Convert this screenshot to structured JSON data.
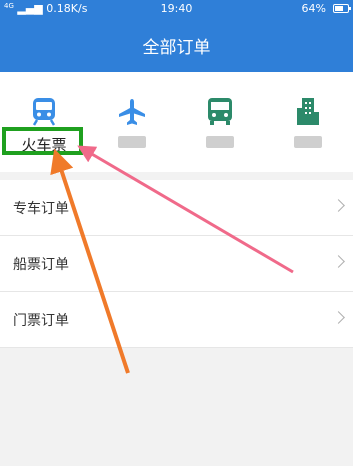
{
  "status_bar": {
    "network": "4G",
    "speed": "0.18K/s",
    "time": "19:40",
    "battery": "64%",
    "battery_level": 0.64
  },
  "header": {
    "title": "全部订单"
  },
  "categories": [
    {
      "label": "火车票",
      "icon": "train-icon",
      "color": "#3a8ee6"
    },
    {
      "label": "",
      "icon": "plane-icon",
      "color": "#3a8ee6"
    },
    {
      "label": "",
      "icon": "bus-icon",
      "color": "#2c8a6a"
    },
    {
      "label": "",
      "icon": "building-icon",
      "color": "#2c8a6a"
    }
  ],
  "orders": [
    {
      "label": "专车订单"
    },
    {
      "label": "船票订单"
    },
    {
      "label": "门票订单"
    }
  ],
  "colors": {
    "brand": "#2f7fd8",
    "highlight": "#1fa01f",
    "arrow_orange": "#f07a2a",
    "arrow_pink": "#f06a8a"
  }
}
